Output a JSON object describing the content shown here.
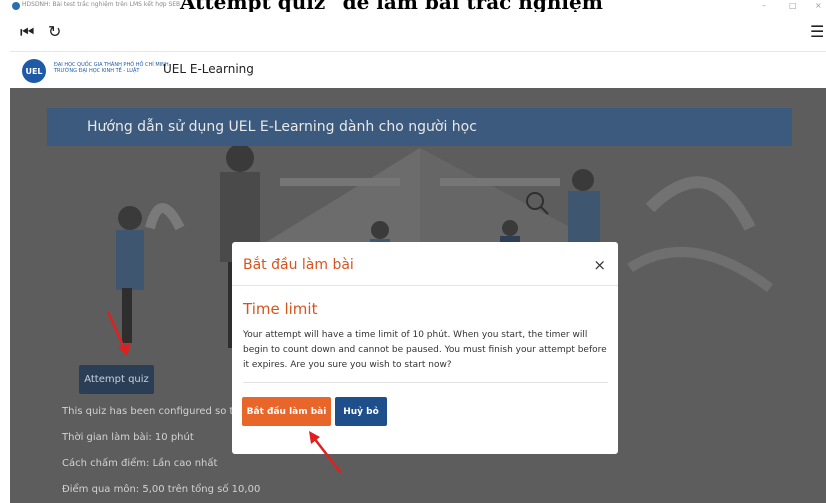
{
  "document": {
    "heading_fragment": "Attempt quiz\" để làm bài trắc nghiệm"
  },
  "window": {
    "tab_title": "HDSDNH: Bài test trắc nghiệm trên LMS kết hợp SEB",
    "minimize": "–",
    "maximize": "□",
    "close": "×"
  },
  "toolbar": {
    "back_glyph": "⏮",
    "reload_glyph": "↻",
    "menu_glyph": "☰"
  },
  "brand": {
    "logo_text": "UEL",
    "small_line_1": "ĐẠI HỌC QUỐC GIA THÀNH PHỐ HỒ CHÍ MINH",
    "small_line_2": "TRƯỜNG ĐẠI HỌC KINH TẾ - LUẬT",
    "title": "UEL E-Learning"
  },
  "hero": {
    "title": "Hướng dẫn sử dụng UEL E-Learning dành cho người học"
  },
  "quiz": {
    "attempt_button": "Attempt quiz",
    "info_lines": [
      "This quiz has been configured so that",
      "Thời gian làm bài: 10 phút",
      "Cách chấm điểm: Lần cao nhất",
      "Điểm qua môn: 5,00 trên tổng số 10,00"
    ]
  },
  "modal": {
    "title": "Bắt đầu làm bài",
    "close_glyph": "×",
    "section_title": "Time limit",
    "body": "Your attempt will have a time limit of 10 phút. When you start, the timer will begin to count down and cannot be paused. You must finish your attempt before it expires. Are you sure you wish to start now?",
    "start_button": "Bắt đầu làm bài",
    "cancel_button": "Huỷ bỏ"
  },
  "colors": {
    "accent_orange": "#e8662a",
    "modal_title": "#d9531e",
    "primary_blue": "#1f4f8a",
    "hero_banner": "#3b5a7d",
    "annotation_red": "#e02020"
  }
}
